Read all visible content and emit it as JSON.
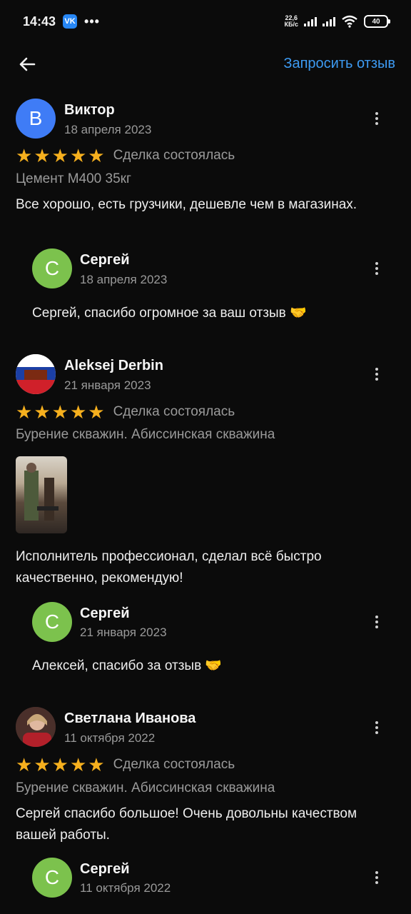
{
  "status_bar": {
    "time": "14:43",
    "vk_label": "VK",
    "net_speed_value": "22,6",
    "net_speed_unit": "КБ/с",
    "battery": "40"
  },
  "header": {
    "back_icon": "arrow-left-icon",
    "request_review": "Запросить отзыв"
  },
  "reviews": [
    {
      "author": "Виктор",
      "initial": "В",
      "date": "18 апреля 2023",
      "rating": 5,
      "deal_status": "Сделка состоялась",
      "service": "Цемент М400 35кг",
      "text": "Все хорошо, есть грузчики, дешевле чем в магазинах.",
      "reply": {
        "author": "Сергей",
        "initial": "С",
        "date": "18 апреля 2023",
        "text": "Сергей, спасибо огромное за ваш отзыв 🤝"
      }
    },
    {
      "author": "Aleksej Derbin",
      "date": "21 января 2023",
      "rating": 5,
      "deal_status": "Сделка состоялась",
      "service": "Бурение скважин. Абиссинская скважина",
      "text": "Исполнитель профессионал, сделал всё быстро качественно, рекомендую!",
      "reply": {
        "author": "Сергей",
        "initial": "С",
        "date": "21 января 2023",
        "text": "Алексей, спасибо за отзыв 🤝"
      }
    },
    {
      "author": "Светлана Иванова",
      "date": "11 октября 2022",
      "rating": 5,
      "deal_status": "Сделка состоялась",
      "service": "Бурение скважин. Абиссинская скважина",
      "text": "Сергей спасибо большое! Очень довольны качеством вашей работы.",
      "reply": {
        "author": "Сергей",
        "initial": "С",
        "date": "11 октября 2022"
      }
    }
  ],
  "colors": {
    "background": "#0b0b0b",
    "accent_link": "#3d9bf3",
    "star": "#f6b01e",
    "avatar_blue": "#3f7cf6",
    "avatar_green": "#7cc24d"
  }
}
